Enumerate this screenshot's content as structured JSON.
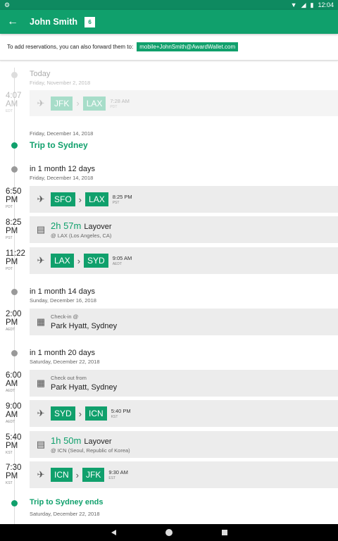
{
  "status": {
    "time": "12:04"
  },
  "appbar": {
    "title": "John Smith",
    "badge": "6"
  },
  "forward": {
    "text": "To add reservations, you can also forward them to:",
    "email": "mobile+JohnSmith@AwardWallet.com"
  },
  "today": {
    "label": "Today",
    "date": "Friday, November 2, 2018"
  },
  "flight0": {
    "time": "4:07",
    "ampm": "AM",
    "tz": "EDT",
    "from": "JFK",
    "to": "LAX",
    "arr": "7:28 AM",
    "arr_tz": "PDT"
  },
  "trip": {
    "date": "Friday, December 14, 2018",
    "title": "Trip to Sydney"
  },
  "g1": {
    "label": "in 1 month 12 days",
    "date": "Friday, December 14, 2018"
  },
  "flight1": {
    "time": "6:50",
    "ampm": "PM",
    "tz": "PDT",
    "from": "SFO",
    "to": "LAX",
    "arr": "8:25 PM",
    "arr_tz": "PST"
  },
  "layover1": {
    "time": "8:25",
    "ampm": "PM",
    "tz": "PST",
    "duration": "2h 57m",
    "label": "Layover",
    "location": "@ LAX (Los Angeles, CA)"
  },
  "flight2": {
    "time": "11:22",
    "ampm": "PM",
    "tz": "PDT",
    "from": "LAX",
    "to": "SYD",
    "arr": "9:05 AM",
    "arr_tz": "AEDT"
  },
  "g2": {
    "label": "in 1 month 14 days",
    "date": "Sunday, December 16, 2018"
  },
  "checkin": {
    "time": "2:00",
    "ampm": "PM",
    "tz": "AEDT",
    "pre": "Check-in @",
    "name": "Park Hyatt, Sydney"
  },
  "g3": {
    "label": "in 1 month 20 days",
    "date": "Saturday, December 22, 2018"
  },
  "checkout": {
    "time": "6:00",
    "ampm": "AM",
    "tz": "AEDT",
    "pre": "Check out from",
    "name": "Park Hyatt, Sydney"
  },
  "flight3": {
    "time": "9:00",
    "ampm": "AM",
    "tz": "AEDT",
    "from": "SYD",
    "to": "ICN",
    "arr": "5:40 PM",
    "arr_tz": "KST"
  },
  "layover2": {
    "time": "5:40",
    "ampm": "PM",
    "tz": "KST",
    "duration": "1h 50m",
    "label": "Layover",
    "location": "@ ICN (Seoul, Republic of Korea)"
  },
  "flight4": {
    "time": "7:30",
    "ampm": "PM",
    "tz": "KST",
    "from": "ICN",
    "to": "JFK",
    "arr": "9:30 AM",
    "arr_tz": "EST"
  },
  "tripend": {
    "title": "Trip to Sydney ends",
    "date": "Saturday, December 22, 2018"
  },
  "colors": {
    "accent": "#10a06c",
    "statusbar": "#0e8a60",
    "card": "#ececec"
  }
}
